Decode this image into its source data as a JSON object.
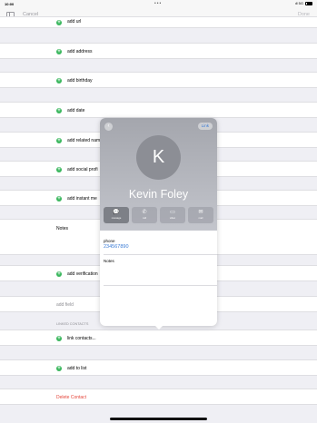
{
  "status_bar": {
    "time": "10:00",
    "dots": "•••",
    "right": "ıll 5G"
  },
  "navbar": {
    "cancel": "Cancel",
    "done": "Done"
  },
  "rows": {
    "add_url": "add url",
    "add_address": "add address",
    "add_birthday": "add birthday",
    "add_date": "add date",
    "add_related_name": "add related nam",
    "add_social_profile": "add social profi",
    "add_instant_message": "add instant me",
    "notes": "Notes",
    "add_verification": "add verification",
    "add_field": "add field",
    "linked_contacts_header": "LINKED CONTACTS",
    "link_contacts": "link contacts...",
    "add_to_list": "add to list",
    "delete_contact": "Delete Contact"
  },
  "popover": {
    "back": "‹",
    "link": "Link",
    "initial": "K",
    "name": "Kevin Foley",
    "actions": [
      {
        "glyph": "💬",
        "label": "message",
        "icon": "message-icon"
      },
      {
        "glyph": "✆",
        "label": "call",
        "icon": "phone-icon"
      },
      {
        "glyph": "▭",
        "label": "video",
        "icon": "video-icon"
      },
      {
        "glyph": "✉",
        "label": "mail",
        "icon": "mail-icon"
      }
    ],
    "phone_label": "phone",
    "phone_value": "234567890",
    "notes_label": "Notes"
  },
  "colors": {
    "add_green": "#3bb75e",
    "link_blue": "#3a7bd5",
    "delete_red": "#e5453a"
  }
}
